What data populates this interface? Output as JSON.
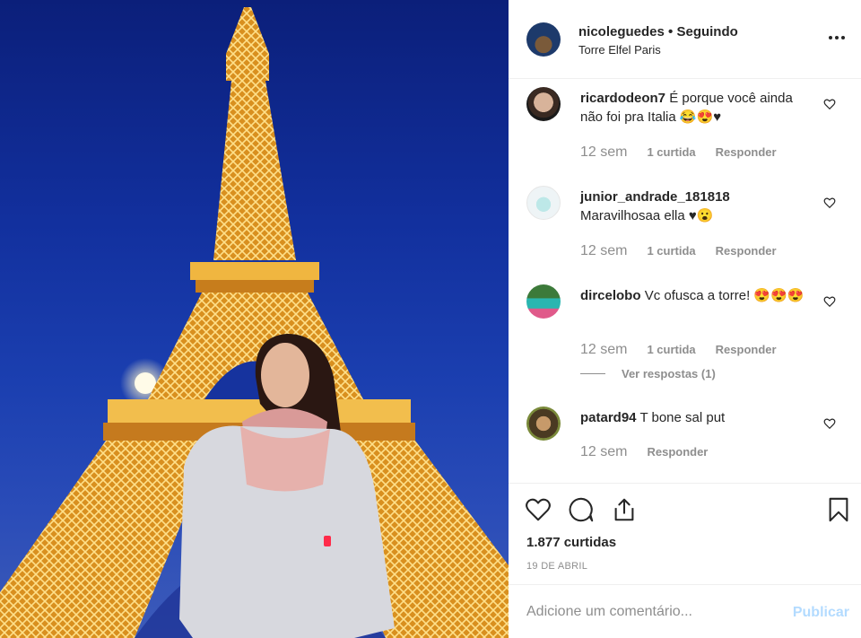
{
  "header": {
    "username": "nicoleguedes",
    "separator": "•",
    "follow_status": "Seguindo",
    "location": "Torre Elfel Paris"
  },
  "comments": [
    {
      "username": "ricardodeon7",
      "text": "É porque você ainda não foi pra Italia 😂😍♥",
      "time": "12 sem",
      "likes": "1 curtida",
      "reply": "Responder"
    },
    {
      "username": "junior_andrade_181818",
      "text": "Maravilhosaa ella ♥😮",
      "time": "12 sem",
      "likes": "1 curtida",
      "reply": "Responder"
    },
    {
      "username": "dircelobo",
      "text": "Vc ofusca a torre! 😍😍😍",
      "time": "12 sem",
      "likes": "1 curtida",
      "reply": "Responder",
      "view_replies": "Ver respostas (1)"
    },
    {
      "username": "patard94",
      "text": "T bone sal put",
      "time": "12 sem",
      "reply": "Responder"
    }
  ],
  "actions": {
    "likes_count": "1.877 curtidas",
    "date": "19 DE ABRIL"
  },
  "comment_box": {
    "placeholder": "Adicione um comentário...",
    "publish_label": "Publicar"
  },
  "icons": [
    "more-icon",
    "heart-icon",
    "comment-icon",
    "share-icon",
    "bookmark-icon"
  ],
  "colors": {
    "link_disabled": "#b3dbff",
    "muted": "#8e8e8e",
    "text": "#262626"
  }
}
